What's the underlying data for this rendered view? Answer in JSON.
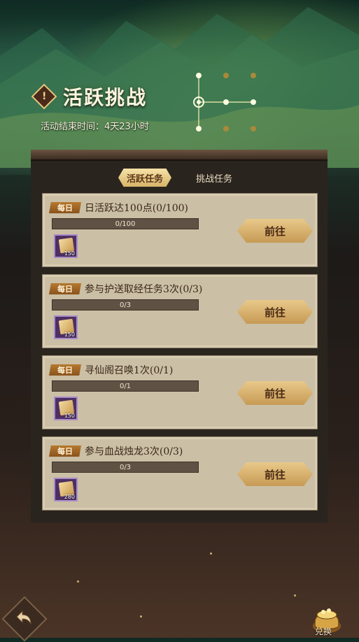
{
  "header": {
    "badge_symbol": "!",
    "title": "活跃挑战",
    "subtitle": "活动结束时间：4天23小时"
  },
  "tabs": [
    {
      "label": "活跃任务",
      "active": true
    },
    {
      "label": "挑战任务",
      "active": false
    }
  ],
  "tasks": [
    {
      "badge": "每日",
      "title": "日活跃达100点(0/100)",
      "progress_text": "0/100",
      "progress": 0,
      "reward_icon": "scroll-icon",
      "reward_count": "150",
      "button": "前往"
    },
    {
      "badge": "每日",
      "title": "参与护送取经任务3次(0/3)",
      "progress_text": "0/3",
      "progress": 0,
      "reward_icon": "scroll-icon",
      "reward_count": "150",
      "button": "前往"
    },
    {
      "badge": "每日",
      "title": "寻仙阁召唤1次(0/1)",
      "progress_text": "0/1",
      "progress": 0,
      "reward_icon": "scroll-icon",
      "reward_count": "150",
      "button": "前往"
    },
    {
      "badge": "每日",
      "title": "参与血战烛龙3次(0/3)",
      "progress_text": "0/3",
      "progress": 0,
      "reward_icon": "scroll-icon",
      "reward_count": "280",
      "button": "前往"
    }
  ],
  "footer": {
    "back_icon": "back-arrow-icon",
    "exchange_icon": "treasure-pot-icon",
    "exchange_label": "兑换"
  },
  "colors": {
    "accent_gold": "#d7b46a",
    "card_bg": "#cbbfa5",
    "reward_frame": "#4d2f63"
  }
}
